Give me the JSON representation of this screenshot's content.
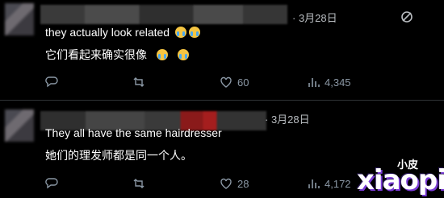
{
  "posts": [
    {
      "date": "· 3月28日",
      "text_en": "they actually look related",
      "text_zh": "它们看起来确实很像",
      "emoji": "loudly-crying-face",
      "stats": {
        "replies": "",
        "reposts": "",
        "likes": "60",
        "views": "4,345"
      }
    },
    {
      "date": "· 3月28日",
      "text_en": "They all have the same hairdresser",
      "text_zh": "她们的理发师都是同一个人。",
      "stats": {
        "replies": "",
        "reposts": "",
        "likes": "28",
        "views": "4,172"
      }
    }
  ],
  "icons": {
    "reply": "reply-icon",
    "repost": "repost-icon",
    "like": "heart-icon",
    "views": "views-icon",
    "bookmark": "bookmark-icon",
    "share": "share-icon",
    "grok": "grok-icon"
  },
  "watermark": {
    "small": "小皮",
    "big": "xiaopi"
  },
  "colors": {
    "background": "#000000",
    "text": "#e7e9ea",
    "muted": "#8b98a5",
    "divider": "#2f3336"
  }
}
